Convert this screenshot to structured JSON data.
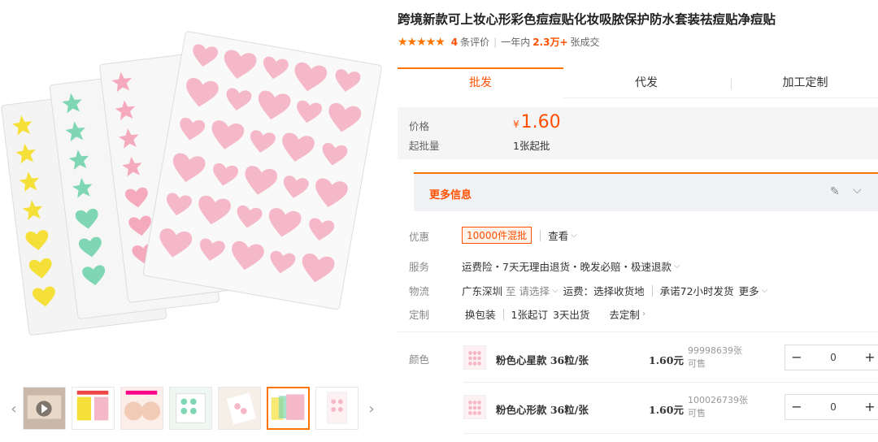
{
  "product": {
    "title": "跨境新款可上妆心形彩色痘痘贴化妆吸脓保护防水套装祛痘贴净痘贴",
    "stars": "★★★★★",
    "review_count": "4",
    "review_label": "条评价",
    "period_label": "一年内",
    "deal_count": "2.3万+",
    "deal_label": "张成交"
  },
  "tabs": [
    {
      "label": "批发",
      "active": true
    },
    {
      "label": "代发",
      "active": false
    },
    {
      "label": "加工定制",
      "active": false
    }
  ],
  "price": {
    "price_label": "价格",
    "currency": "¥",
    "value": "1.60",
    "min_label": "起批量",
    "min_value": "1张起批"
  },
  "more_info": {
    "label": "更多信息"
  },
  "rows": {
    "promo": {
      "label": "优惠",
      "tag": "10000件混批",
      "action": "查看"
    },
    "service": {
      "label": "服务",
      "text": "运费险・7天无理由退货・晚发必赔・极速退款"
    },
    "logistics": {
      "label": "物流",
      "from": "广东深圳",
      "to_label": "至",
      "to_placeholder": "请选择",
      "freight": "运费：选择收货地",
      "promise": "承诺72小时发货",
      "more": "更多"
    },
    "custom": {
      "label": "定制",
      "option": "换包装",
      "min": "1张起订",
      "lead": "3天出货",
      "link": "去定制"
    }
  },
  "variants": {
    "label": "颜色",
    "items": [
      {
        "name": "粉色心星款 36粒/张",
        "price": "1.60元",
        "stock": "99998639张",
        "stock_label": "可售",
        "qty": "0"
      },
      {
        "name": "粉色心形款 36粒/张",
        "price": "1.60元",
        "stock": "100026739张",
        "stock_label": "可售",
        "qty": "0"
      }
    ]
  },
  "colors": {
    "accent": "#ff5000",
    "tab_accent": "#ff7300",
    "heart_pink": "#f5b8c8",
    "star_yellow": "#f5e03a",
    "star_green": "#7fd6b4"
  }
}
